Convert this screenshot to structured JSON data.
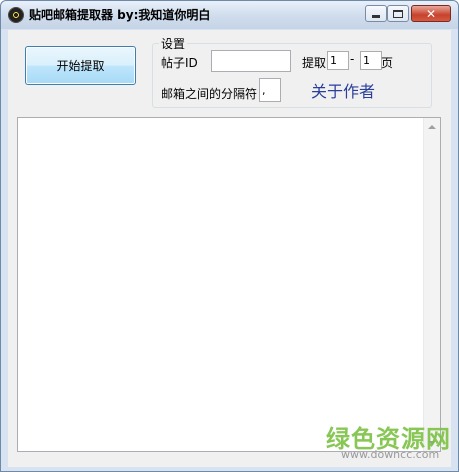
{
  "window": {
    "title": "贴吧邮箱提取器 by:我知道你明白",
    "icon": "radiation-icon",
    "close_glyph": "✕"
  },
  "toolbar": {
    "start_label": "开始提取"
  },
  "settings": {
    "group_label": "设置",
    "post_id_label": "帖子ID",
    "post_id_value": "",
    "extract_label": "提取",
    "from_page_value": "1",
    "range_dash": "-",
    "to_page_value": "1",
    "page_label": "页",
    "separator_label": "邮箱之间的分隔符",
    "separator_value": ",",
    "about_label": "关于作者"
  },
  "output": {
    "value": ""
  },
  "watermark": {
    "text_cn": "绿色资源网",
    "url": "www.downcc.com"
  },
  "colors": {
    "about_link": "#2a3f9b",
    "watermark": "#7cc243",
    "button_border": "#3c7fb1"
  }
}
